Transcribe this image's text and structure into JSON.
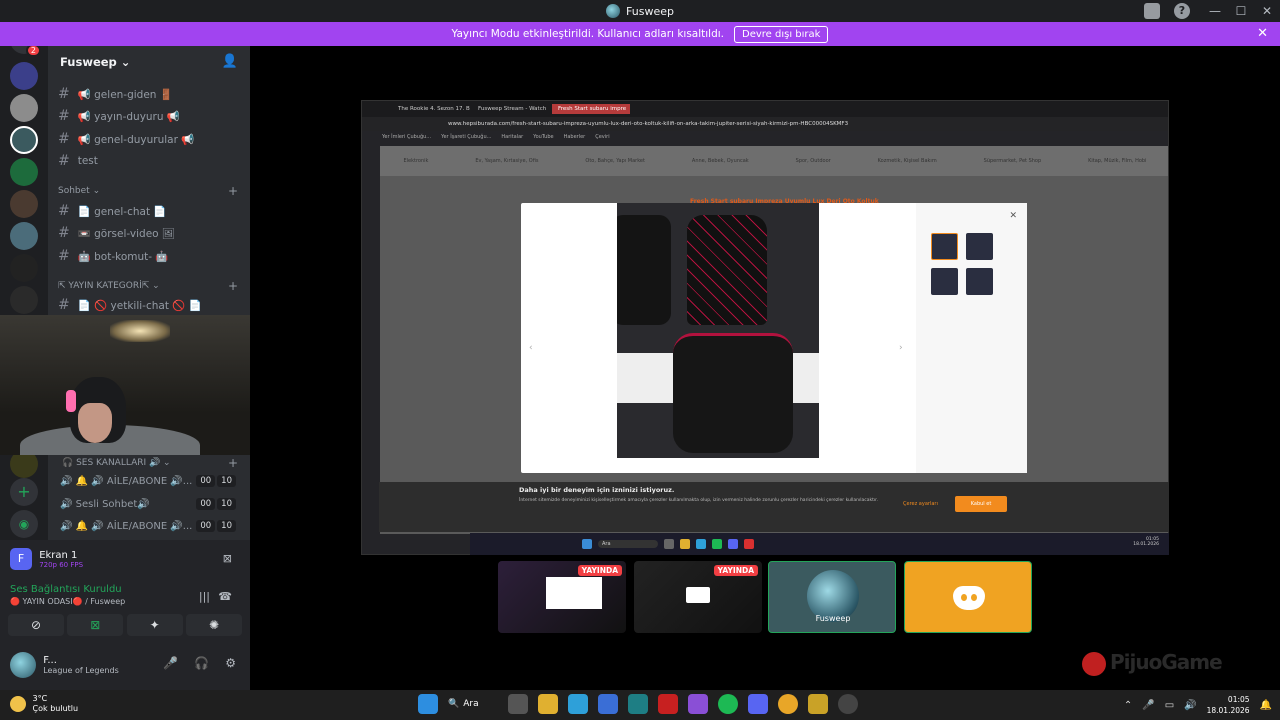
{
  "window": {
    "title": "Fusweep",
    "controls": [
      "—",
      "☐",
      "✕"
    ]
  },
  "notice": {
    "text": "Yayıncı Modu etkinleştirildi. Kullanıcı adları kısaltıldı.",
    "button": "Devre dışı bırak",
    "close": "✕"
  },
  "rail": {
    "badge": "2"
  },
  "server": {
    "name": "Fusweep ⌄"
  },
  "channels": [
    {
      "name": "📢 gelen-giden 🚪"
    },
    {
      "name": "📢 yayın-duyuru 📢"
    },
    {
      "name": "📢 genel-duyurular 📢"
    },
    {
      "name": "test"
    }
  ],
  "category_sohbet": "Sohbet ⌄",
  "sohbet_channels": [
    {
      "name": "📄 genel-chat 📄"
    },
    {
      "name": "📼 görsel-video 🖼"
    },
    {
      "name": "🤖 bot-komut- 🤖"
    }
  ],
  "category_yayin": "⇱ YAYIN KATEGORİ⇱ ⌄",
  "yayin_channels": [
    {
      "name": "📄 🚫 yetkili-chat 🚫 📄"
    }
  ],
  "voice_category": "🎧 SES KANALLARI 🔊 ⌄",
  "voice_channels": [
    {
      "name": "🔔 🔊 AİLE/ABONE 🔊...",
      "count": "00",
      "limit": "10"
    },
    {
      "name": "Sesli Sohbet🔊",
      "count": "00",
      "limit": "10"
    },
    {
      "name": "🔔 🔊 AİLE/ABONE 🔊...",
      "count": "00",
      "limit": "10"
    }
  ],
  "screen_share": {
    "title": "Ekran 1",
    "quality": "720p 60 FPS",
    "letter": "F"
  },
  "connection": {
    "status": "Ses Bağlantısı Kuruldu",
    "channel": "🔴 YAYIN ODASI🔴 / Fusweep"
  },
  "user": {
    "name": "F...",
    "activity": "League of Legends"
  },
  "browser": {
    "tabs": [
      "The Rookie 4. Sezon 17. B",
      "Fusweep Stream - Watch",
      "Fresh Start subaru impre"
    ],
    "url": "www.hepsiburada.com/fresh-start-subaru-impreza-uyumlu-lux-deri-oto-koltuk-kilifi-on-arka-takim-jupiter-serisi-siyah-kirmizi-pm-HBC00004SKMF3",
    "bookmarks": [
      "Yer İmleri Çubuğu...",
      "Yer İşareti Çubuğu...",
      "Haritalar",
      "YouTube",
      "Haberler",
      "Çeviri"
    ],
    "nav": [
      "Elektronik",
      "Ev, Yaşam, Kırtasiye, Ofis",
      "Oto, Bahçe, Yapı Market",
      "Anne, Bebek, Oyuncak",
      "Spor, Outdoor",
      "Kozmetik, Kişisel Bakım",
      "Süpermarket, Pet Shop",
      "Kitap, Müzik, Film, Hobi"
    ],
    "product_title": "Fresh Start subaru Impreza Uyumlu Lux Deri Oto Koltuk",
    "cookie_title": "Daha iyi bir deneyim için izninizi istiyoruz.",
    "cookie_text": "İnternet sitemizde deneyiminizi kişiselleştirmek amacıyla çerezler kullanılmakta olup, izin vermeniz halinde zorunlu çerezler haricindeki çerezler kullanılacaktır.",
    "cookie_settings": "Çerez ayarları",
    "cookie_accept": "Kabul et",
    "clock_time": "01:05",
    "clock_date": "18.01.2026",
    "search": "Ara"
  },
  "tiles": [
    {
      "label": "YAYINDA"
    },
    {
      "label": "YAYINDA"
    },
    {
      "name": "Fusweep"
    }
  ],
  "watermark": "PijuoGame",
  "taskbar": {
    "temp": "3°C",
    "weather": "Çok bulutlu",
    "search": "Ara",
    "time": "01:05",
    "date": "18.01.2026"
  }
}
